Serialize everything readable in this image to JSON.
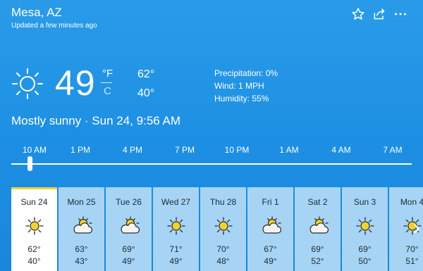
{
  "location": {
    "city": "Mesa, AZ",
    "updated": "Updated a few minutes ago"
  },
  "icons": {
    "favorite": "star-icon",
    "share": "share-icon",
    "more": "more-icon"
  },
  "current": {
    "temp": "49",
    "unit_f": "°F",
    "unit_c": "C",
    "high": "62°",
    "low": "40°",
    "precipitation": "Precipitation: 0%",
    "wind": "Wind: 1 MPH",
    "humidity": "Humidity: 55%",
    "condition": "Mostly sunny · Sun 24, 9:56 AM",
    "icon": "sunny-icon"
  },
  "hourly": {
    "labels": [
      "10 AM",
      "1 PM",
      "4 PM",
      "7 PM",
      "10 PM",
      "1 AM",
      "4 AM",
      "7 AM"
    ],
    "slider_position": 0.0
  },
  "daily": [
    {
      "day": "Sun 24",
      "icon": "sunny",
      "high": "62°",
      "low": "40°"
    },
    {
      "day": "Mon 25",
      "icon": "partly-cloudy",
      "high": "63°",
      "low": "43°"
    },
    {
      "day": "Tue 26",
      "icon": "partly-cloudy",
      "high": "69°",
      "low": "49°"
    },
    {
      "day": "Wed 27",
      "icon": "sunny",
      "high": "71°",
      "low": "49°"
    },
    {
      "day": "Thu 28",
      "icon": "sunny",
      "high": "70°",
      "low": "48°"
    },
    {
      "day": "Fri 1",
      "icon": "partly-cloudy",
      "high": "67°",
      "low": "49°"
    },
    {
      "day": "Sat 2",
      "icon": "partly-cloudy",
      "high": "69°",
      "low": "52°"
    },
    {
      "day": "Sun 3",
      "icon": "sunny",
      "high": "69°",
      "low": "50°"
    },
    {
      "day": "Mon 4",
      "icon": "sunny",
      "high": "70°",
      "low": "51°"
    }
  ],
  "colors": {
    "background": "#1d8fe3",
    "selected_bar": "#f0d238",
    "sun": "#f3d32b"
  }
}
